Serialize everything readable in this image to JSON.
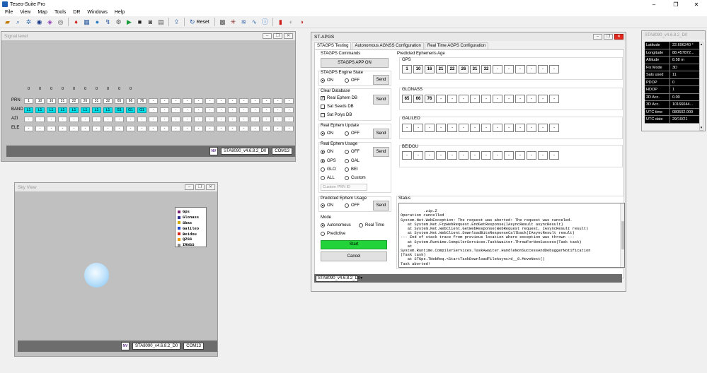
{
  "app": {
    "title": "Teseo-Suite Pro",
    "win_min": "–",
    "win_max": "❐",
    "win_close": "✕"
  },
  "menu": [
    "File",
    "View",
    "Map",
    "Tools",
    "DR",
    "Windows",
    "Help"
  ],
  "toolbar": {
    "reset_label": "Reset"
  },
  "signal_level": {
    "title": "Signal level",
    "zeros": [
      "0",
      "0",
      "0",
      "0",
      "0",
      "0",
      "0",
      "0",
      "0",
      "0"
    ],
    "row_labels": {
      "prn": "PRN",
      "band": "BAND",
      "azi": "AZI",
      "ele": "ELE"
    },
    "prn": [
      "1",
      "10",
      "16",
      "21",
      "22",
      "26",
      "31",
      "32",
      "65",
      "66",
      "76",
      "-",
      "-",
      "-",
      "-",
      "-",
      "-",
      "-",
      "-",
      "-",
      "-",
      "-",
      "-",
      "-"
    ],
    "band": [
      "L1",
      "L1",
      "L1",
      "L1",
      "L1",
      "L1",
      "L1",
      "L1",
      "G1",
      "G1",
      "G1",
      "-",
      "-",
      "-",
      "-",
      "-",
      "-",
      "-",
      "-",
      "-",
      "-",
      "-",
      "-",
      "-"
    ],
    "azi": [
      "-",
      "-",
      "-",
      "-",
      "-",
      "-",
      "-",
      "-",
      "-",
      "-",
      "-",
      "-",
      "-",
      "-",
      "-",
      "-",
      "-",
      "-",
      "-",
      "-",
      "-",
      "-",
      "-",
      "-"
    ],
    "ele": [
      "-",
      "-",
      "-",
      "-",
      "-",
      "-",
      "-",
      "-",
      "-",
      "-",
      "-",
      "-",
      "-",
      "-",
      "-",
      "-",
      "-",
      "-",
      "-",
      "-",
      "-",
      "-",
      "-",
      "-"
    ],
    "footer_logo": "NV",
    "firmware": "STA8090_v4.6.8.2_D0",
    "port": "COM13"
  },
  "sky_view": {
    "title": "Sky View",
    "legend": [
      {
        "name": "Gps",
        "color": "#7a1f6e"
      },
      {
        "name": "Glonass",
        "color": "#2a2a8a"
      },
      {
        "name": "Sbas",
        "color": "#caa800"
      },
      {
        "name": "Galileo",
        "color": "#1a40c8"
      },
      {
        "name": "Beidou",
        "color": "#d8201a"
      },
      {
        "name": "QZSS",
        "color": "#e89a00"
      },
      {
        "name": "IRNSS",
        "color": "#8a8a8a"
      }
    ],
    "footer_logo": "NV",
    "firmware": "STA8090_v4.6.8.2_D0",
    "port": "COM13"
  },
  "apgs": {
    "title": "ST-APGS",
    "tabs": [
      "STAGPS Testing",
      "Autonomous AGNSS Configuration",
      "Real Time AGPS Configuration"
    ],
    "stagps_commands_label": "STAGPS Commands",
    "stagps_app_btn": "STAGPS APP ON",
    "engine_state_label": "STAGPS Engine State",
    "on": "ON",
    "off": "OFF",
    "send": "Send",
    "clear_db_label": "Clear Database",
    "real_ephem_db": "Real Ephem DB",
    "sat_seeds_db": "Sat Seeds DB",
    "sat_polys_db": "Sat Polys DB",
    "real_ephem_update_label": "Real Ephem Update",
    "real_ephem_usage_label": "Real Ephem Usage",
    "gps": "GPS",
    "gal": "GAL",
    "glo": "GLO",
    "bei": "BEI",
    "all": "ALL",
    "custom": "Custom",
    "custom_prn_placeholder": "Custom PRN ID",
    "pred_ephem_usage_label": "Predicted Ephem Usage",
    "mode_label": "Mode",
    "autonomous": "Autonomous",
    "real_time": "Real Time",
    "predictive": "Predictive",
    "start_btn": "Start",
    "cancel_btn": "Cancel",
    "pred_ephem_age_label": "Predicted Ephemeris Age",
    "gps_label": "GPS",
    "gps_prn": [
      "1",
      "10",
      "16",
      "21",
      "22",
      "26",
      "31",
      "32",
      "-",
      "-",
      "-",
      "-",
      "-",
      "-"
    ],
    "glonass_label": "GLONASS",
    "glonass_prn": [
      "65",
      "66",
      "76",
      "-",
      "-",
      "-",
      "-",
      "-",
      "-",
      "-",
      "-",
      "-",
      "-",
      "-"
    ],
    "galileo_label": "GALILEO",
    "galileo_prn": [
      "-",
      "-",
      "-",
      "-",
      "-",
      "-",
      "-",
      "-",
      "-",
      "-",
      "-",
      "-",
      "-",
      "-"
    ],
    "beidou_label": "BEIDOU",
    "beidou_prn": [
      "-",
      "-",
      "-",
      "-",
      "-",
      "-",
      "-",
      "-",
      "-",
      "-",
      "-",
      "-",
      "-",
      "-"
    ],
    "status_label": "Status",
    "status_text": ".zip.Z\nOperation cancelled\nSystem.Net.WebException: The request was aborted: The request was canceled.\n   at System.Net.FtpWebRequest.EndGetResponse(IAsyncResult asyncResult)\n   at System.Net.WebClient.GetWebResponse(WebRequest request, IAsyncResult result)\n   at System.Net.WebClient.DownloadBitsResponseCallback(IAsyncResult result)\n--- End of stack trace from previous location where exception was thrown ---\n   at System.Runtime.CompilerServices.TaskAwaiter.ThrowForNonSuccess(Task task)\n   at\nSystem.Runtime.CompilerServices.TaskAwaiter.HandleNonSuccessAndDebuggerNotification\n(Task task)\n   at STGps.TWebReq.<StartTaskDownloadFileAsync>d__8.MoveNext()\nTask aborted!",
    "firmware_combo": "STA8090_v4.6.8.2_D0"
  },
  "position": {
    "title": "STA8090_v4.6.8.2_D0",
    "rows": [
      {
        "k": "Latitude",
        "v": "22.696240 °"
      },
      {
        "k": "Longitude",
        "v": "88.457872..."
      },
      {
        "k": "Altitude",
        "v": "8.58 m"
      },
      {
        "k": "Fix Mode",
        "v": "3D"
      },
      {
        "k": "Sats used",
        "v": "11"
      },
      {
        "k": "PDOP",
        "v": "0"
      },
      {
        "k": "HDOP",
        "v": "1"
      },
      {
        "k": "2D Acc.",
        "v": "0.00"
      },
      {
        "k": "3D Acc.",
        "v": "10166044..."
      },
      {
        "k": "UTC time",
        "v": "080502.000"
      },
      {
        "k": "UTC date",
        "v": "29/10/21"
      }
    ]
  }
}
